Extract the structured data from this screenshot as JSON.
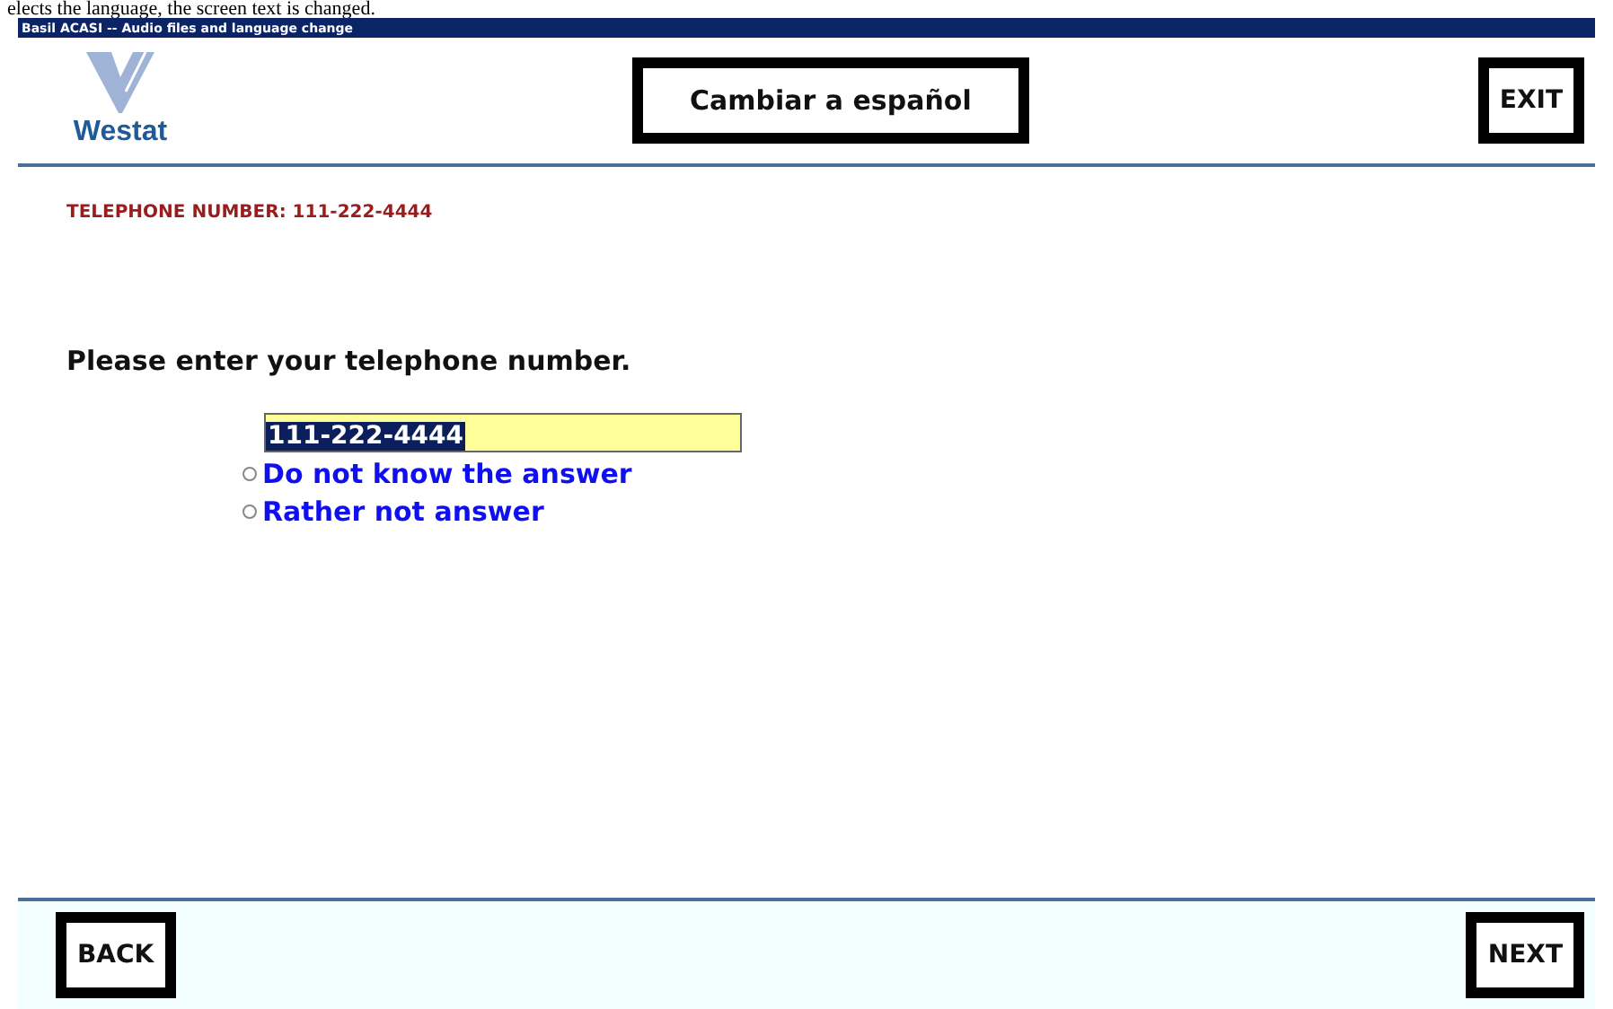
{
  "document_caption": "elects the language, the screen text is changed.",
  "window": {
    "title": "Basil ACASI -- Audio files and language change"
  },
  "header": {
    "logo_text": "Westat",
    "language_button": "Cambiar a español",
    "exit_button": "EXIT"
  },
  "info_label": "TELEPHONE NUMBER: 111-222-4444",
  "question": "Please enter your telephone number.",
  "answer_field": {
    "value": "111-222-4444",
    "text_selected": true
  },
  "options": [
    {
      "label": "Do not know the answer",
      "selected": false
    },
    {
      "label": "Rather not answer",
      "selected": false
    }
  ],
  "footer": {
    "back_button": "BACK",
    "next_button": "NEXT"
  }
}
